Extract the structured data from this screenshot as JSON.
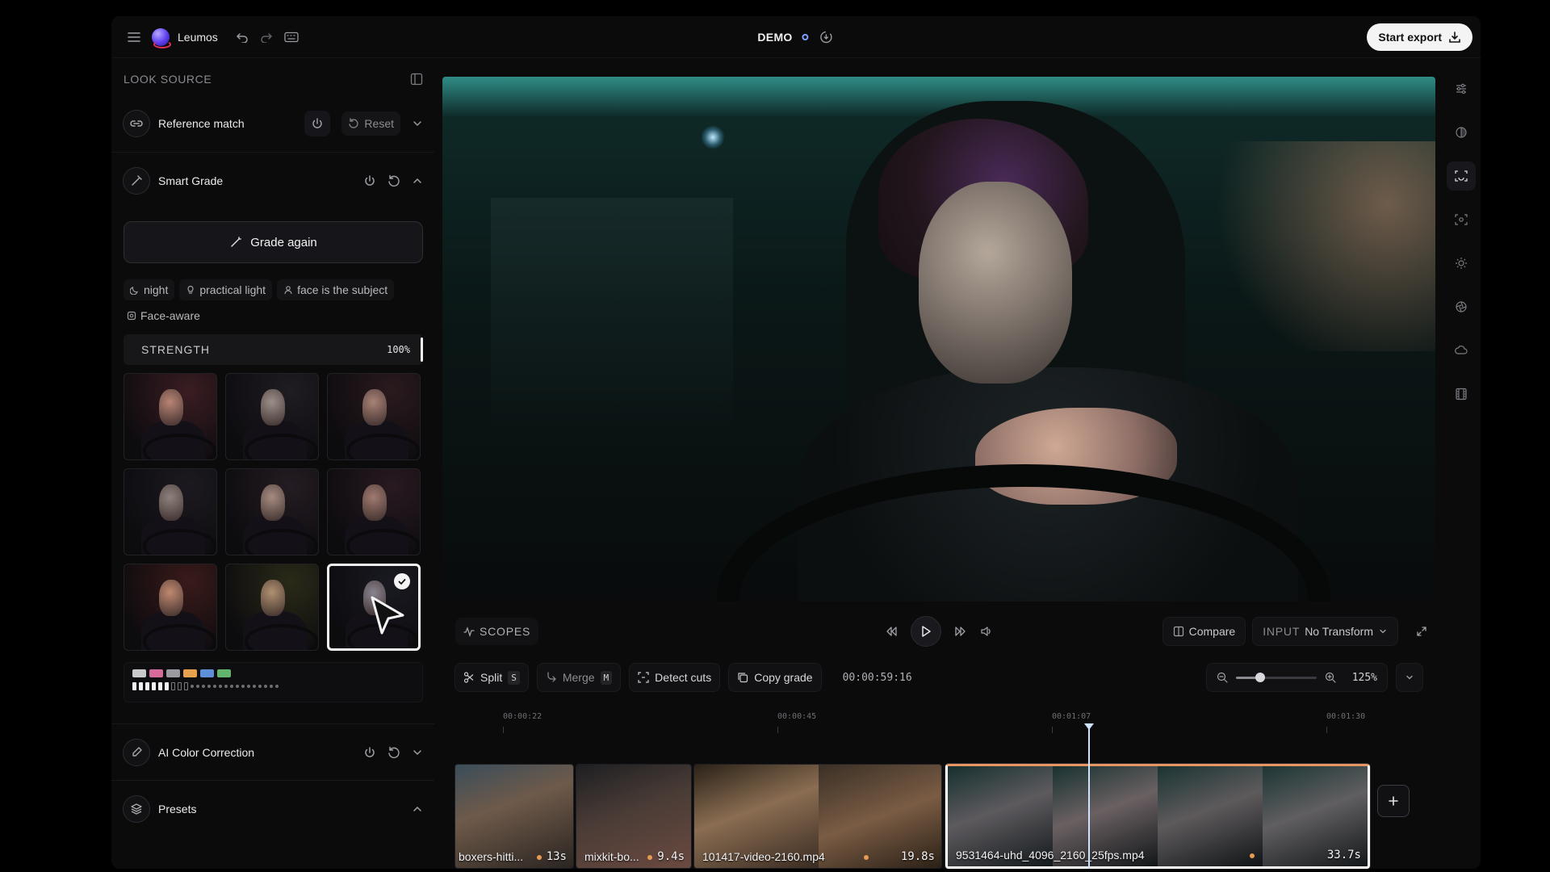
{
  "header": {
    "app_name": "Leumos",
    "project": "DEMO",
    "export_label": "Start export"
  },
  "look_source": {
    "title": "LOOK SOURCE",
    "reference_match": {
      "label": "Reference match",
      "reset_label": "Reset"
    },
    "smart_grade": {
      "label": "Smart Grade",
      "grade_again_label": "Grade again"
    },
    "tags": [
      {
        "icon": "moon-icon",
        "label": "night"
      },
      {
        "icon": "lightbulb-icon",
        "label": "practical light"
      },
      {
        "icon": "person-icon",
        "label": "face is the subject"
      },
      {
        "icon": "face-scan-icon",
        "label": "Face-aware"
      }
    ],
    "strength": {
      "label": "STRENGTH",
      "value": "100%"
    },
    "variants_selected_index": 8,
    "palette": {
      "swatches": [
        "#c9c9cc",
        "#d46b9a",
        "#9a9aa0",
        "#e7a14e",
        "#5f8fd8",
        "#62b56a"
      ],
      "filled_bars": 6,
      "empty_bars": 3,
      "dots": 16
    },
    "ai_color_correction": {
      "label": "AI Color Correction"
    },
    "presets": {
      "label": "Presets"
    }
  },
  "transport": {
    "scopes_label": "SCOPES",
    "compare_label": "Compare",
    "input_label": "INPUT",
    "input_value": "No Transform"
  },
  "toolbar": {
    "split": {
      "label": "Split",
      "key": "S"
    },
    "merge": {
      "label": "Merge",
      "key": "M"
    },
    "detect_cuts_label": "Detect cuts",
    "copy_grade_label": "Copy grade",
    "timecode": "00:00:59:16",
    "zoom": "125%",
    "zoom_level": 0.3
  },
  "timeline": {
    "ticks": [
      "00:00:22",
      "00:00:45",
      "00:01:07",
      "00:01:30"
    ],
    "clips": [
      {
        "name": "boxers-hitti...",
        "duration": "13s"
      },
      {
        "name": "mixkit-bo...",
        "duration": "9.4s"
      },
      {
        "name": "101417-video-2160.mp4",
        "duration": "19.8s"
      },
      {
        "name": "9531464-uhd_4096_2160_25fps.mp4",
        "duration": "33.7s"
      }
    ]
  },
  "right_rail": [
    "sliders-icon",
    "color-wheel-icon",
    "face-scan-icon",
    "focus-icon",
    "sun-icon",
    "aperture-icon",
    "cloud-icon",
    "film-icon"
  ]
}
